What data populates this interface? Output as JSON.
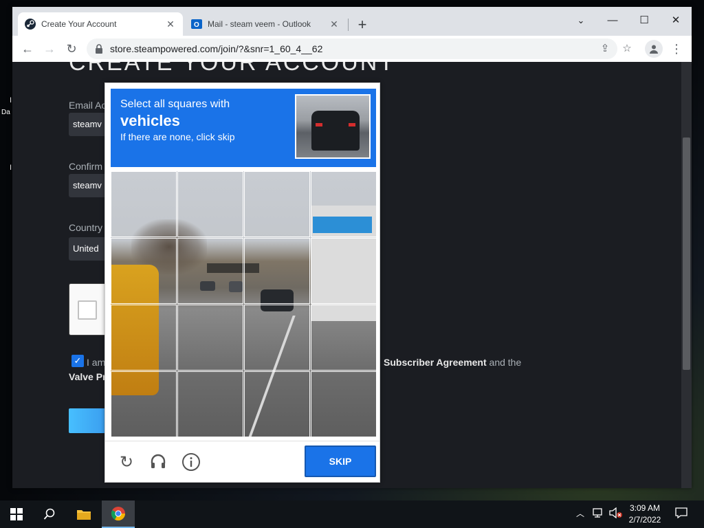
{
  "browser": {
    "tabs": [
      {
        "title": "Create Your Account",
        "icon": "steam-icon",
        "active": true
      },
      {
        "title": "Mail - steam veem - Outlook",
        "icon": "outlook-icon",
        "active": false
      }
    ],
    "url": "store.steampowered.com/join/?&snr=1_60_4__62",
    "new_tab_label": "+"
  },
  "page": {
    "title": "CREATE YOUR ACCOUNT",
    "email_label": "Email Ac",
    "email_value": "steamv",
    "confirm_label": "Confirm",
    "confirm_value": "steamv",
    "country_label": "Country",
    "country_value": "United",
    "agree_text": "I am",
    "agree_suffix_link": "Subscriber Agreement",
    "agree_suffix_after": " and the",
    "valve_privacy": "Valve Pr"
  },
  "captcha": {
    "line1": "Select all squares with",
    "keyword": "vehicles",
    "line3": "If there are none, click skip",
    "skip_label": "SKIP"
  },
  "desktop": {
    "left_text_1": "I",
    "left_text_2": "Da",
    "left_text_3": "I"
  },
  "taskbar": {
    "time": "3:09 AM",
    "date": "2/7/2022"
  },
  "colors": {
    "captcha_blue": "#1a73e8",
    "steam_bg": "#1b1d22"
  }
}
